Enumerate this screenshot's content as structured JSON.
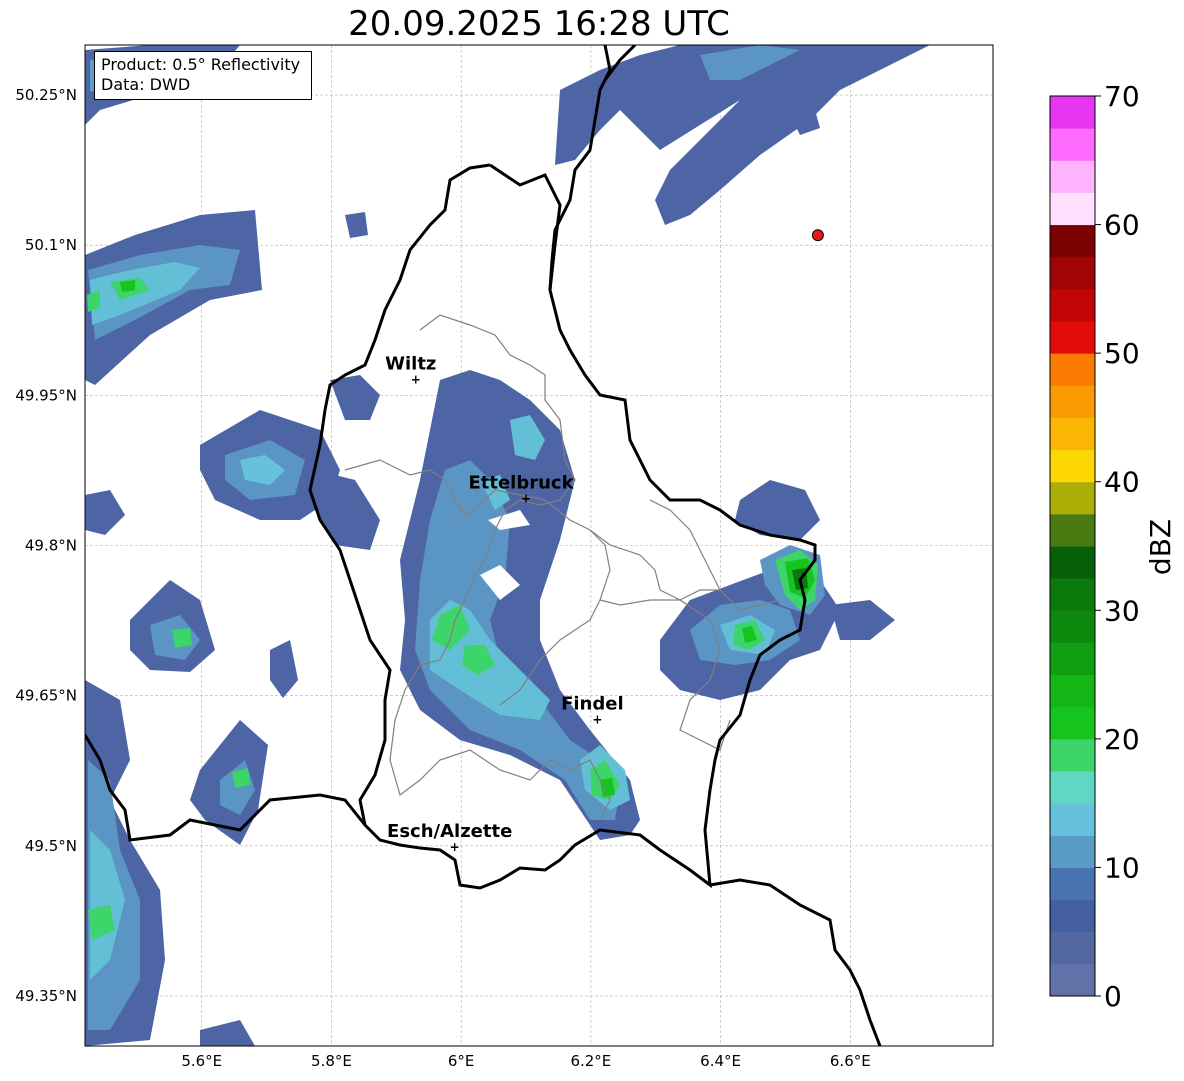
{
  "title": "20.09.2025 16:28 UTC",
  "info": {
    "product": "Product: 0.5° Reflectivity",
    "data": "Data: DWD"
  },
  "map": {
    "lon_range": [
      5.42,
      6.82
    ],
    "lat_range": [
      49.3,
      50.3
    ],
    "x_ticks": [
      {
        "value": 5.6,
        "label": "5.6°E"
      },
      {
        "value": 5.8,
        "label": "5.8°E"
      },
      {
        "value": 6.0,
        "label": "6°E"
      },
      {
        "value": 6.2,
        "label": "6.2°E"
      },
      {
        "value": 6.4,
        "label": "6.4°E"
      },
      {
        "value": 6.6,
        "label": "6.6°E"
      }
    ],
    "y_ticks": [
      {
        "value": 50.25,
        "label": "50.25°N"
      },
      {
        "value": 50.1,
        "label": "50.1°N"
      },
      {
        "value": 49.95,
        "label": "49.95°N"
      },
      {
        "value": 49.8,
        "label": "49.8°N"
      },
      {
        "value": 49.65,
        "label": "49.65°N"
      },
      {
        "value": 49.5,
        "label": "49.5°N"
      },
      {
        "value": 49.35,
        "label": "49.35°N"
      }
    ],
    "cities": [
      {
        "name": "Wiltz",
        "lon": 5.93,
        "lat": 49.967
      },
      {
        "name": "Ettelbruck",
        "lon": 6.1,
        "lat": 49.848
      },
      {
        "name": "Findel",
        "lon": 6.21,
        "lat": 49.627
      },
      {
        "name": "Esch/Alzette",
        "lon": 5.99,
        "lat": 49.5
      }
    ],
    "marker": {
      "lon": 6.55,
      "lat": 50.11,
      "color": "#e8191b"
    }
  },
  "colorbar": {
    "label": "dBZ",
    "ticks": [
      0,
      10,
      20,
      30,
      40,
      50,
      60,
      70
    ],
    "colors": [
      "#6272a8",
      "#53689f",
      "#435ea1",
      "#4774b0",
      "#5b9cc6",
      "#66c2dc",
      "#60d6c4",
      "#3dd46a",
      "#16c41e",
      "#13b614",
      "#0f9e10",
      "#0d8a0e",
      "#0b7a0c",
      "#085f0a",
      "#4a7a12",
      "#acae08",
      "#fcd704",
      "#fbb505",
      "#fb9b03",
      "#fb7b02",
      "#e20c0a",
      "#c20606",
      "#a00404",
      "#7c0202",
      "#ffe0ff",
      "#ffb3ff",
      "#ff6aff",
      "#e736f2"
    ]
  }
}
